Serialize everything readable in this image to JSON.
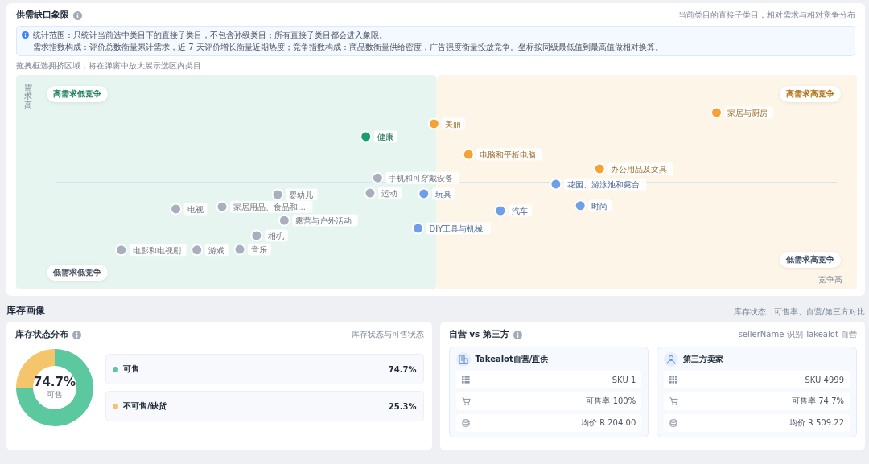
{
  "gap_quadrant": {
    "title": "供需缺口象限",
    "subtitle": "当前类目的直接子类目，相对需求与相对竞争分布",
    "notes": [
      "统计范围：只统计当前选中类目下的直接子类目，不包含孙级类目；所有直接子类目都会进入象限。",
      "需求指数构成：评价总数衡量累计需求，近 7 天评价增长衡量近期热度；竞争指数构成：商品数衡量供给密度，广告强度衡量投放竞争。坐标按同级最低值到最高值做相对换算。"
    ],
    "hint": "拖拽框选拥挤区域，将在弹窗中放大展示选区内类目",
    "quadrants": [
      {
        "label": "高需求低竞争",
        "kind": "top-left",
        "color": "#1b7f58"
      },
      {
        "label": "高需求高竞争",
        "kind": "top-right",
        "color": "#b0700f"
      },
      {
        "label": "低需求高竞争",
        "kind": "bottom-right",
        "color": "#3f4d66"
      },
      {
        "label": "低需求低竞争",
        "kind": "bottom-left",
        "color": "#4b5563"
      }
    ],
    "demand_axis": "需求高",
    "competition_axis": "竞争高",
    "points": [
      {
        "label": "健康",
        "color": "#1a9e6e"
      },
      {
        "label": "美丽",
        "color": "#f4a236"
      },
      {
        "label": "家居与厨房",
        "color": "#f4a236"
      },
      {
        "label": "电脑和平板电脑",
        "color": "#f4a236"
      },
      {
        "label": "办公用品及文具",
        "color": "#f4a236"
      },
      {
        "label": "花园、游泳池和露台",
        "color": "#6f9fe8"
      },
      {
        "label": "手机和可穿戴设备",
        "color": "#a8afbf"
      },
      {
        "label": "运动",
        "color": "#a8afbf"
      },
      {
        "label": "玩具",
        "color": "#6f9fe8"
      },
      {
        "label": "汽车",
        "color": "#6f9fe8"
      },
      {
        "label": "时尚",
        "color": "#6f9fe8"
      },
      {
        "label": "DIY工具与机械",
        "color": "#6f9fe8"
      },
      {
        "label": "婴幼儿",
        "color": "#a8afbf"
      },
      {
        "label": "电视",
        "color": "#a8afbf"
      },
      {
        "label": "家居用品、食品和…",
        "color": "#a8afbf"
      },
      {
        "label": "露营与户外活动",
        "color": "#a8afbf"
      },
      {
        "label": "相机",
        "color": "#a8afbf"
      },
      {
        "label": "电影和电视剧",
        "color": "#a8afbf"
      },
      {
        "label": "游戏",
        "color": "#a8afbf"
      },
      {
        "label": "音乐",
        "color": "#a8afbf"
      }
    ]
  },
  "inventory": {
    "title": "库存画像",
    "subtitle": "库存状态、可售率、自营/第三方对比",
    "status": {
      "title": "库存状态分布",
      "subtitle": "库存状态与可售状态",
      "center_value": "74.7%",
      "center_label": "可售",
      "chart_data": {
        "type": "donut",
        "categories": [
          "可售",
          "不可售/缺货"
        ],
        "series": [
          {
            "values": [
              74.7,
              25.3
            ]
          }
        ]
      },
      "legend": [
        {
          "value": "74.7%",
          "color": "#5bc8a0"
        },
        {
          "value": "25.3%",
          "color": "#f5c56b"
        }
      ]
    },
    "sellers": {
      "title": "自营 vs 第三方",
      "subtitle": "sellerName 识别 Takealot 自营",
      "groups": [
        {
          "kind": "retail",
          "title": "Takealot自营/直供",
          "rows": [
            {
              "kind": "sku",
              "text": "SKU 1"
            },
            {
              "kind": "rate",
              "text": "可售率 100%"
            },
            {
              "kind": "price",
              "text": "均价 R 204.00"
            }
          ]
        },
        {
          "kind": "marketplace",
          "title": "第三方卖家",
          "rows": [
            {
              "kind": "sku",
              "text": "SKU 4999"
            },
            {
              "kind": "rate",
              "text": "可售率 74.7%"
            },
            {
              "kind": "price",
              "text": "均价 R 509.22"
            }
          ]
        }
      ]
    }
  }
}
